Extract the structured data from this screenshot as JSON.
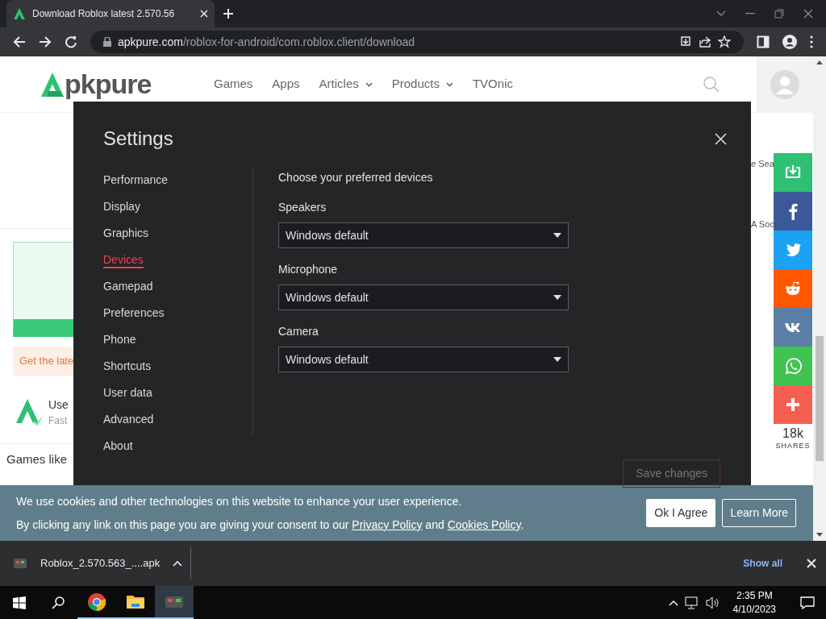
{
  "browser": {
    "tab_title": "Download Roblox latest 2.570.56",
    "url_domain": "apkpure.com",
    "url_path": "/roblox-for-android/com.roblox.client/download"
  },
  "site_header": {
    "logo": "pkpure",
    "nav": [
      {
        "label": "Games",
        "dropdown": false
      },
      {
        "label": "Apps",
        "dropdown": false
      },
      {
        "label": "Articles",
        "dropdown": true
      },
      {
        "label": "Products",
        "dropdown": true
      },
      {
        "label": "TVOnic",
        "dropdown": false
      }
    ]
  },
  "page_left": {
    "banner_text": "Get the late",
    "app_title": "Use",
    "app_subtitle": "Fast",
    "section_title": "Games like"
  },
  "page_right": {
    "fragments": [
      "e Sea",
      "A Soc"
    ]
  },
  "settings": {
    "title": "Settings",
    "nav": [
      {
        "label": "Performance",
        "selected": false
      },
      {
        "label": "Display",
        "selected": false
      },
      {
        "label": "Graphics",
        "selected": false
      },
      {
        "label": "Devices",
        "selected": true
      },
      {
        "label": "Gamepad",
        "selected": false
      },
      {
        "label": "Preferences",
        "selected": false
      },
      {
        "label": "Phone",
        "selected": false
      },
      {
        "label": "Shortcuts",
        "selected": false
      },
      {
        "label": "User data",
        "selected": false
      },
      {
        "label": "Advanced",
        "selected": false
      },
      {
        "label": "About",
        "selected": false
      }
    ],
    "heading": "Choose your preferred devices",
    "devices": [
      {
        "label": "Speakers",
        "value": "Windows default"
      },
      {
        "label": "Microphone",
        "value": "Windows default"
      },
      {
        "label": "Camera",
        "value": "Windows default"
      }
    ],
    "save_button": {
      "label": "Save changes",
      "disabled": true
    }
  },
  "share_bar": {
    "buttons": [
      {
        "kind": "download",
        "color": "#2fc073"
      },
      {
        "kind": "facebook",
        "color": "#3b5998"
      },
      {
        "kind": "twitter",
        "color": "#1da1f2"
      },
      {
        "kind": "reddit",
        "color": "#ff5700"
      },
      {
        "kind": "vk",
        "color": "#5b7fa6"
      },
      {
        "kind": "whatsapp",
        "color": "#40c351"
      },
      {
        "kind": "more",
        "color": "#f65e4f"
      }
    ],
    "count": "18k",
    "label": "SHARES"
  },
  "cookie_banner": {
    "line1": "We use cookies and other technologies on this website to enhance your user experience.",
    "line2": [
      {
        "text": "By clicking any link on this page you are giving your consent to our ",
        "link": false
      },
      {
        "text": "Privacy Policy",
        "link": true
      },
      {
        "text": " and ",
        "link": false
      },
      {
        "text": "Cookies Policy",
        "link": true
      },
      {
        "text": ".",
        "link": false
      }
    ],
    "buttons": [
      {
        "label": "Ok I Agree",
        "kind": "solid"
      },
      {
        "label": "Learn More",
        "kind": "outline"
      }
    ]
  },
  "download_bar": {
    "file": "Roblox_2.570.563_....apk",
    "show_all": "Show all"
  },
  "taskbar": {
    "apps": [
      {
        "kind": "chrome",
        "active": false,
        "running": true
      },
      {
        "kind": "folder",
        "active": false,
        "running": true
      },
      {
        "kind": "roblox",
        "active": true,
        "running": true
      }
    ],
    "time": "2:35 PM",
    "date": "4/10/2023"
  }
}
